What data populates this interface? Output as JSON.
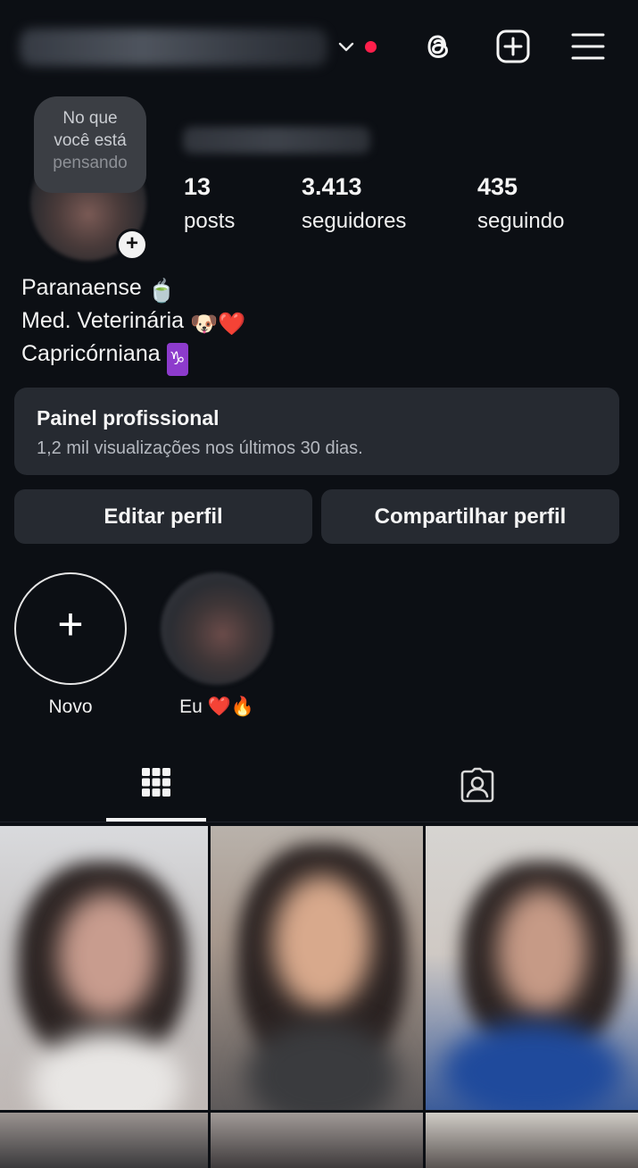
{
  "header": {
    "username": "larissa.mairaleal26",
    "icons": [
      "chevron-down-icon",
      "notification-dot",
      "threads-icon",
      "add-post-icon",
      "menu-icon"
    ]
  },
  "profile": {
    "note_line1": "No que",
    "note_line2": "você está",
    "note_line3": "pensando",
    "display_name": "Larissa Mendes",
    "stats": {
      "posts_count": "13",
      "posts_label": "posts",
      "followers_count": "3.413",
      "followers_label": "seguidores",
      "following_count": "435",
      "following_label": "seguindo"
    },
    "bio": {
      "line1": "Paranaense",
      "line1_emoji": "🍵",
      "line2": "Med. Veterinária",
      "line2_emoji": "🐶❤️",
      "line3": "Capricórniana",
      "line3_emoji": "♑"
    }
  },
  "dashboard": {
    "title": "Painel profissional",
    "subtitle": "1,2 mil visualizações nos últimos 30 dias."
  },
  "buttons": {
    "edit": "Editar perfil",
    "share": "Compartilhar perfil"
  },
  "highlights": [
    {
      "label": "Novo"
    },
    {
      "label": "Eu ❤️🔥"
    }
  ],
  "tabs": [
    "posts-grid-icon",
    "tagged-icon"
  ],
  "colors": {
    "background": "#0c0f14",
    "card": "#262a31",
    "accent_dot": "#ff1f4b"
  }
}
